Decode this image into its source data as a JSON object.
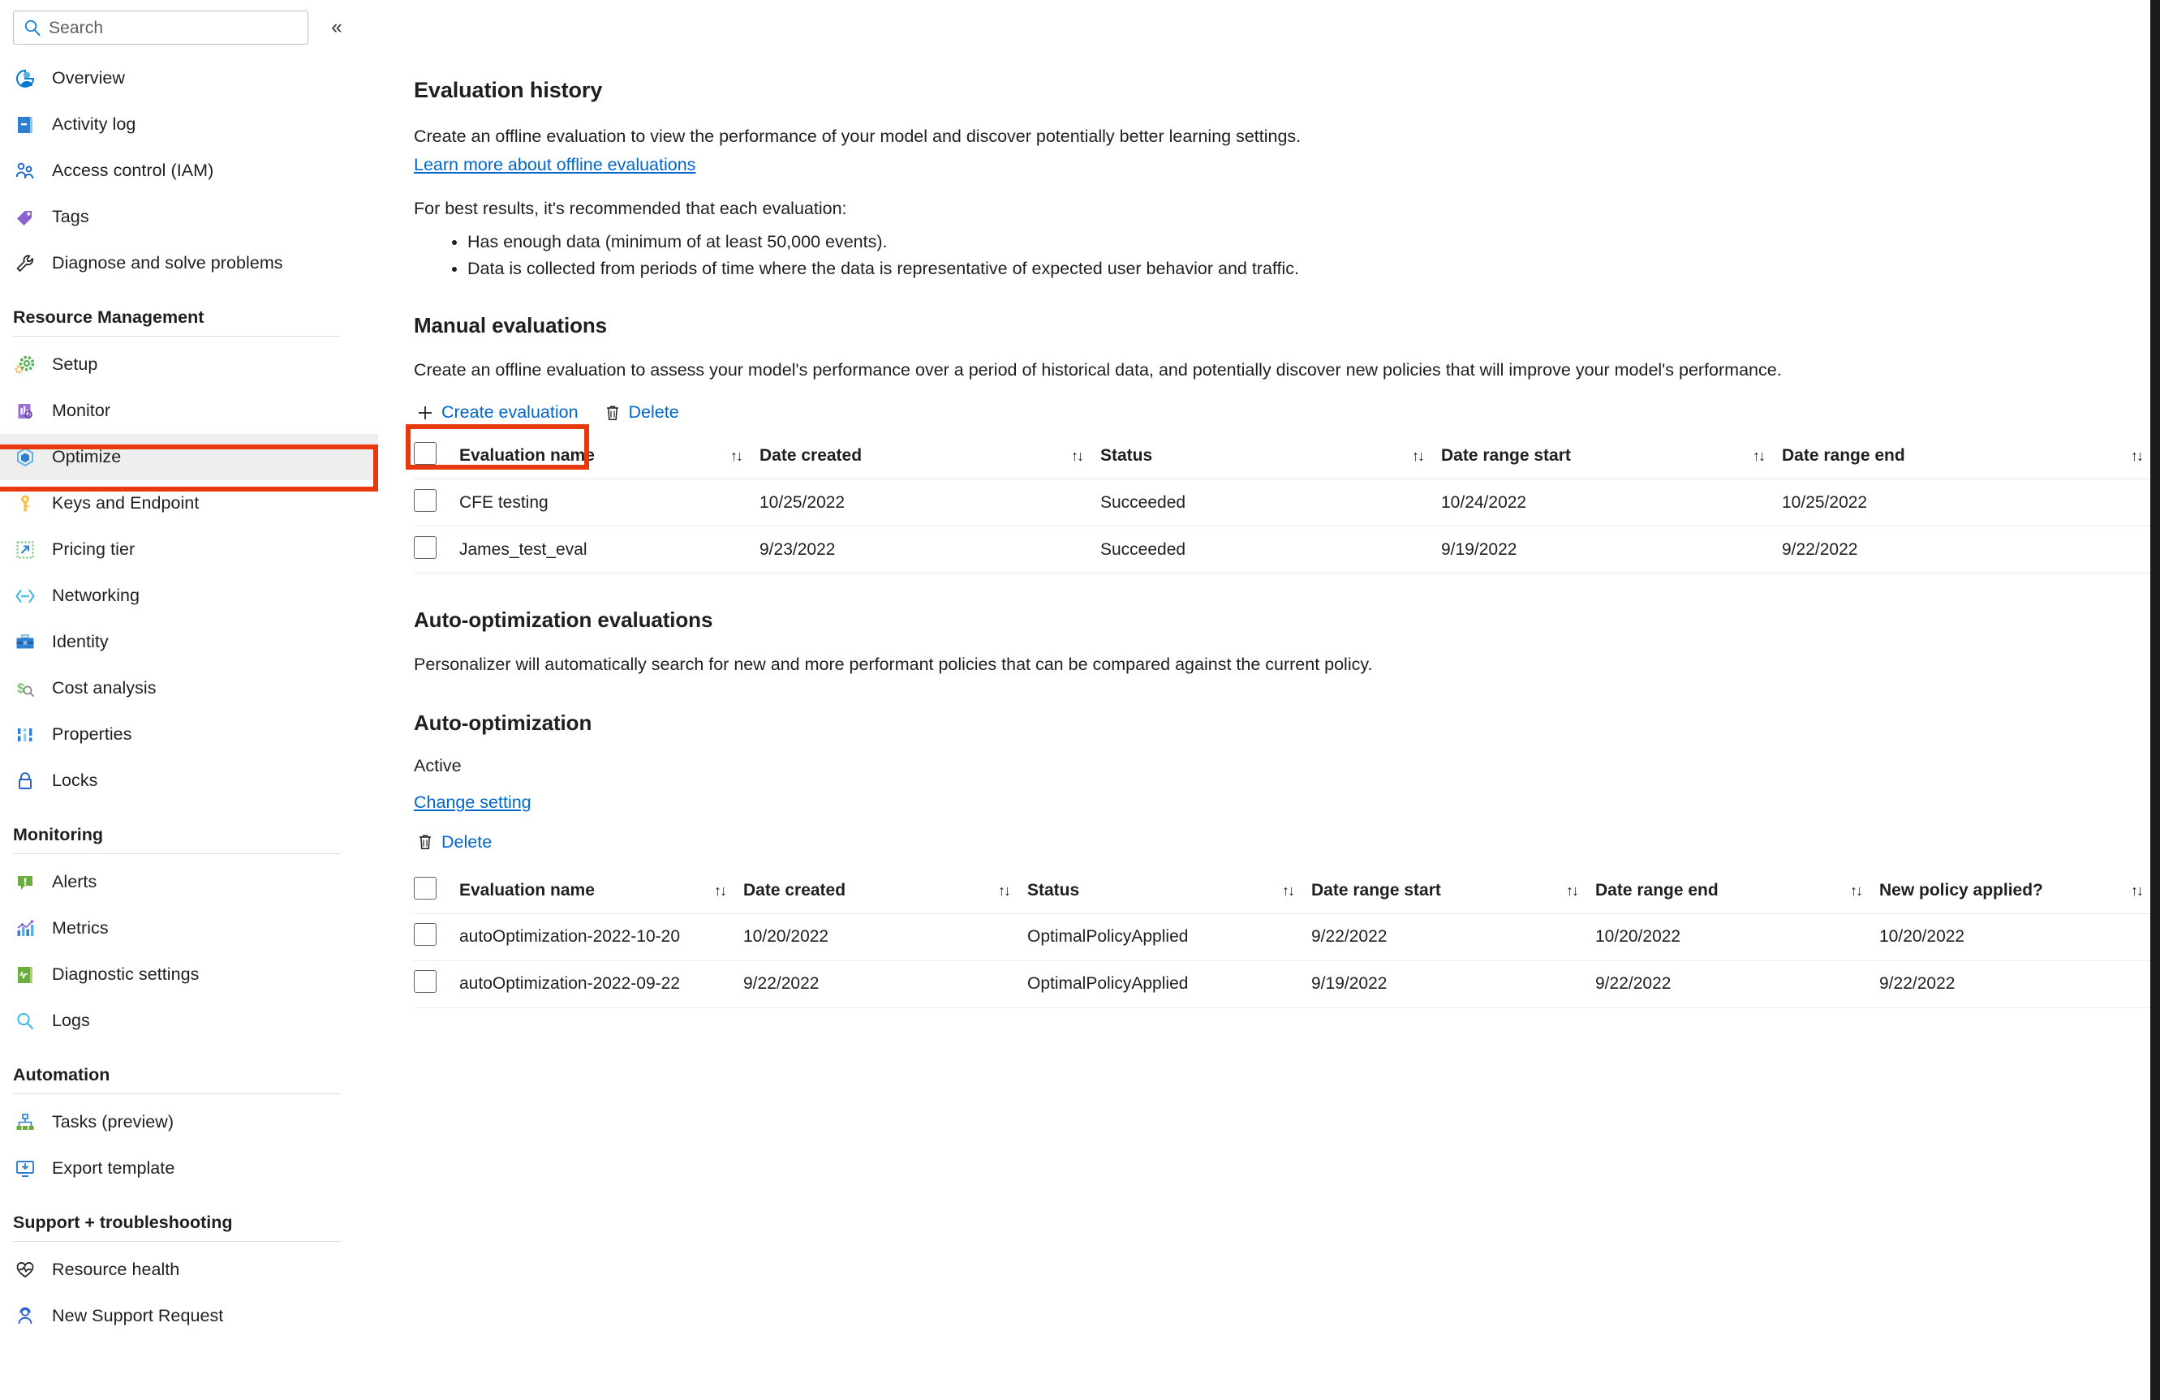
{
  "sidebar": {
    "search": {
      "placeholder": "Search",
      "icon": "search-icon"
    },
    "collapse": {
      "glyph": "«",
      "name": "collapse-panel-icon"
    },
    "top_items": [
      {
        "label": "Overview",
        "icon": "overview-icon"
      },
      {
        "label": "Activity log",
        "icon": "activity-log-icon"
      },
      {
        "label": "Access control (IAM)",
        "icon": "access-control-icon"
      },
      {
        "label": "Tags",
        "icon": "tags-icon"
      },
      {
        "label": "Diagnose and solve problems",
        "icon": "wrench-icon"
      }
    ],
    "groups": [
      {
        "title": "Resource Management",
        "items": [
          {
            "label": "Setup",
            "icon": "gear-icon"
          },
          {
            "label": "Monitor",
            "icon": "monitor-icon"
          },
          {
            "label": "Optimize",
            "icon": "optimize-icon",
            "selected": true
          },
          {
            "label": "Keys and Endpoint",
            "icon": "key-icon"
          },
          {
            "label": "Pricing tier",
            "icon": "pricing-tier-icon"
          },
          {
            "label": "Networking",
            "icon": "networking-icon"
          },
          {
            "label": "Identity",
            "icon": "identity-icon"
          },
          {
            "label": "Cost analysis",
            "icon": "cost-analysis-icon"
          },
          {
            "label": "Properties",
            "icon": "properties-icon"
          },
          {
            "label": "Locks",
            "icon": "lock-icon"
          }
        ]
      },
      {
        "title": "Monitoring",
        "items": [
          {
            "label": "Alerts",
            "icon": "alerts-icon"
          },
          {
            "label": "Metrics",
            "icon": "metrics-icon"
          },
          {
            "label": "Diagnostic settings",
            "icon": "diagnostic-settings-icon"
          },
          {
            "label": "Logs",
            "icon": "logs-search-icon"
          }
        ]
      },
      {
        "title": "Automation",
        "items": [
          {
            "label": "Tasks (preview)",
            "icon": "tasks-icon"
          },
          {
            "label": "Export template",
            "icon": "export-template-icon"
          }
        ]
      },
      {
        "title": "Support + troubleshooting",
        "items": [
          {
            "label": "Resource health",
            "icon": "heart-pulse-icon"
          },
          {
            "label": "New Support Request",
            "icon": "support-person-icon"
          }
        ]
      }
    ]
  },
  "main": {
    "page_title": "Evaluation history",
    "intro_paragraph": "Create an offline evaluation to view the performance of your model and discover potentially better learning settings.",
    "intro_link": "Learn more about offline evaluations",
    "recommend_lead": "For best results, it's recommended that each evaluation:",
    "recommend_bullets": [
      "Has enough data (minimum of at least 50,000 events).",
      "Data is collected from periods of time where the data is representative of expected user behavior and traffic."
    ],
    "manual": {
      "heading": "Manual evaluations",
      "description": "Create an offline evaluation to assess your model's performance over a period of historical data, and potentially discover new policies that will improve your model's performance.",
      "create_label": "Create evaluation",
      "create_icon": "plus-icon",
      "delete_label": "Delete",
      "delete_icon": "trash-icon",
      "columns": [
        "Evaluation name",
        "Date created",
        "Status",
        "Date range start",
        "Date range end"
      ],
      "rows": [
        {
          "name": "CFE testing",
          "date_created": "10/25/2022",
          "status": "Succeeded",
          "range_start": "10/24/2022",
          "range_end": "10/25/2022"
        },
        {
          "name": "James_test_eval",
          "date_created": "9/23/2022",
          "status": "Succeeded",
          "range_start": "9/19/2022",
          "range_end": "9/22/2022"
        }
      ]
    },
    "auto_eval": {
      "heading": "Auto-optimization evaluations",
      "description": "Personalizer will automatically search for new and more performant policies that can be compared against the current policy."
    },
    "auto_opt": {
      "heading": "Auto-optimization",
      "status_value": "Active",
      "change_setting_label": "Change setting",
      "delete_label": "Delete",
      "delete_icon": "trash-icon",
      "columns": [
        "Evaluation name",
        "Date created",
        "Status",
        "Date range start",
        "Date range end",
        "New policy applied?"
      ],
      "rows": [
        {
          "name": "autoOptimization-2022-10-20",
          "date_created": "10/20/2022",
          "status": "OptimalPolicyApplied",
          "range_start": "9/22/2022",
          "range_end": "10/20/2022",
          "new_policy": "10/20/2022"
        },
        {
          "name": "autoOptimization-2022-09-22",
          "date_created": "9/22/2022",
          "status": "OptimalPolicyApplied",
          "range_start": "9/19/2022",
          "range_end": "9/22/2022",
          "new_policy": "9/22/2022"
        }
      ]
    },
    "sort_glyph": "↑↓"
  },
  "annotations": {
    "accent_color": "#e8380d",
    "items": [
      {
        "name": "optimize-highlight-box"
      },
      {
        "name": "create-evaluation-highlight-box"
      }
    ]
  }
}
